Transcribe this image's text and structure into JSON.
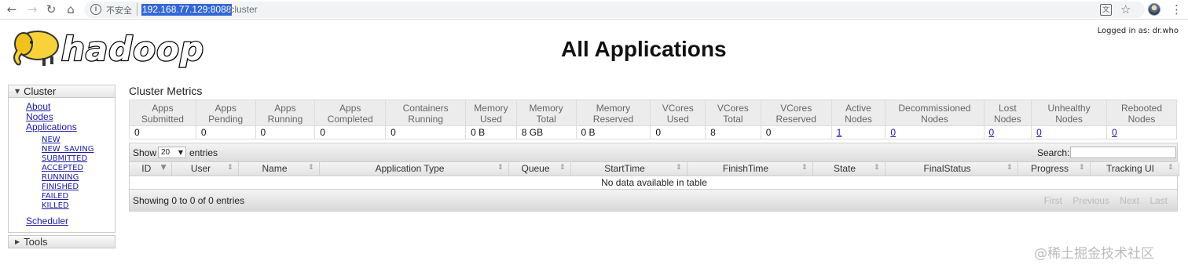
{
  "browser": {
    "insecure_label": "不安全",
    "url_host": "192.168.77.129:8088",
    "url_path": "/cluster"
  },
  "header": {
    "logo_text": "hadoop",
    "title": "All Applications",
    "logged_in": "Logged in as: dr.who"
  },
  "sidebar": {
    "cluster_label": "Cluster",
    "about": "About",
    "nodes": "Nodes",
    "applications": "Applications",
    "app_states": [
      "NEW",
      "NEW_SAVING",
      "SUBMITTED",
      "ACCEPTED",
      "RUNNING",
      "FINISHED",
      "FAILED",
      "KILLED"
    ],
    "scheduler": "Scheduler",
    "tools_label": "Tools"
  },
  "metrics": {
    "caption": "Cluster Metrics",
    "headers": [
      [
        "Apps",
        "Submitted"
      ],
      [
        "Apps",
        "Pending"
      ],
      [
        "Apps",
        "Running"
      ],
      [
        "Apps",
        "Completed"
      ],
      [
        "Containers",
        "Running"
      ],
      [
        "Memory",
        "Used"
      ],
      [
        "Memory",
        "Total"
      ],
      [
        "Memory",
        "Reserved"
      ],
      [
        "VCores",
        "Used"
      ],
      [
        "VCores",
        "Total"
      ],
      [
        "VCores",
        "Reserved"
      ],
      [
        "Active",
        "Nodes"
      ],
      [
        "Decommissioned",
        "Nodes"
      ],
      [
        "Lost",
        "Nodes"
      ],
      [
        "Unhealthy",
        "Nodes"
      ],
      [
        "Rebooted",
        "Nodes"
      ]
    ],
    "values": [
      "0",
      "0",
      "0",
      "0",
      "0",
      "0 B",
      "8 GB",
      "0 B",
      "0",
      "8",
      "0",
      "1",
      "0",
      "0",
      "0",
      "0"
    ]
  },
  "apps_table": {
    "show_label": "Show",
    "entries_value": "20",
    "entries_label": "entries",
    "search_label": "Search:",
    "columns": [
      "ID",
      "User",
      "Name",
      "Application Type",
      "Queue",
      "StartTime",
      "FinishTime",
      "State",
      "FinalStatus",
      "Progress",
      "Tracking UI"
    ],
    "empty_message": "No data available in table",
    "showing": "Showing 0 to 0 of 0 entries",
    "pager": [
      "First",
      "Previous",
      "Next",
      "Last"
    ]
  },
  "watermark": "@稀土掘金技术社区"
}
